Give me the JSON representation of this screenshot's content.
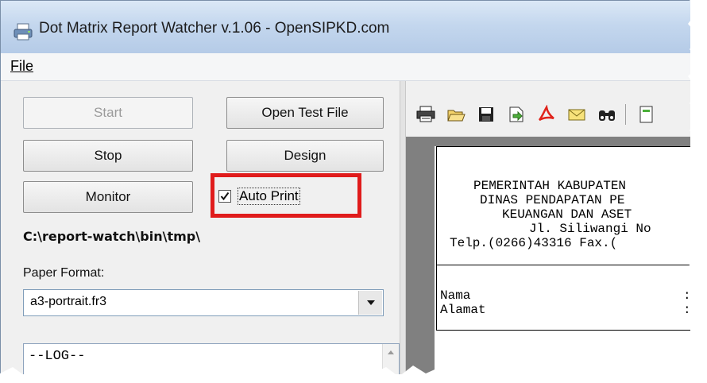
{
  "window": {
    "title": "Dot Matrix Report Watcher v.1.06 - OpenSIPKD.com"
  },
  "menu": {
    "file": "File"
  },
  "buttons": {
    "start": "Start",
    "open_test_file": "Open Test File",
    "stop": "Stop",
    "design": "Design",
    "monitor": "Monitor"
  },
  "auto_print": {
    "label": "Auto Print",
    "checked": true
  },
  "path": "C:\\report-watch\\bin\\tmp\\",
  "paper_format": {
    "label": "Paper Format:",
    "value": "a3-portrait.fr3"
  },
  "log": {
    "text": "--LOG--"
  },
  "toolbar": {
    "icons": [
      "print-icon",
      "open-folder-icon",
      "save-icon",
      "export-icon",
      "pdf-icon",
      "email-icon",
      "find-icon",
      "page-icon"
    ]
  },
  "report": {
    "header_lines": [
      "PEMERINTAH KABUPATEN",
      "DINAS PENDAPATAN PE",
      "KEUANGAN DAN ASET",
      "Jl. Siliwangi No",
      "Telp.(0266)43316 Fax.("
    ],
    "fields": [
      {
        "label": "Nama",
        "sep": ":"
      },
      {
        "label": "Alamat",
        "sep": ":"
      }
    ]
  },
  "colors": {
    "highlight": "#e01c1c",
    "titlebar": "#c4d7ee"
  }
}
